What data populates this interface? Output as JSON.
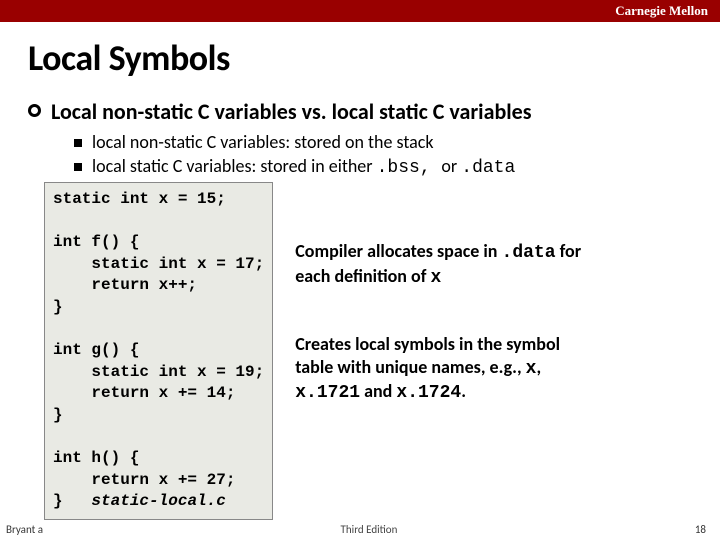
{
  "header": {
    "university": "Carnegie Mellon"
  },
  "title": "Local Symbols",
  "lvl1_text": "Local non-static C variables vs. local static C variables",
  "sub": {
    "a": "local non-static C variables: stored on the stack",
    "b_prefix": "local static C variables: stored in either ",
    "b_code1": ".bss, ",
    "b_mid": "or ",
    "b_code2": ".data"
  },
  "code_lines": [
    "static int x = 15;",
    "",
    "int f() {",
    "    static int x = 17;",
    "    return x++;",
    "}",
    "",
    "int g() {",
    "    static int x = 19;",
    "    return x += 14;",
    "}",
    "",
    "int h() {",
    "    return x += 27;",
    "}"
  ],
  "filename": "static-local.c",
  "notes": {
    "n1_a": "Compiler allocates space in ",
    "n1_code": ".data",
    "n1_b": " for each definition of ",
    "n1_var": "x",
    "n2_a": "Creates local symbols in the symbol table with unique names, e.g., ",
    "n2_v1": "x",
    "n2_b": ", ",
    "n2_v2": "x.1721",
    "n2_c": " and ",
    "n2_v3": "x.1724",
    "n2_d": "."
  },
  "footer": {
    "left": "Bryant a",
    "mid": "Third Edition",
    "page": "18"
  }
}
